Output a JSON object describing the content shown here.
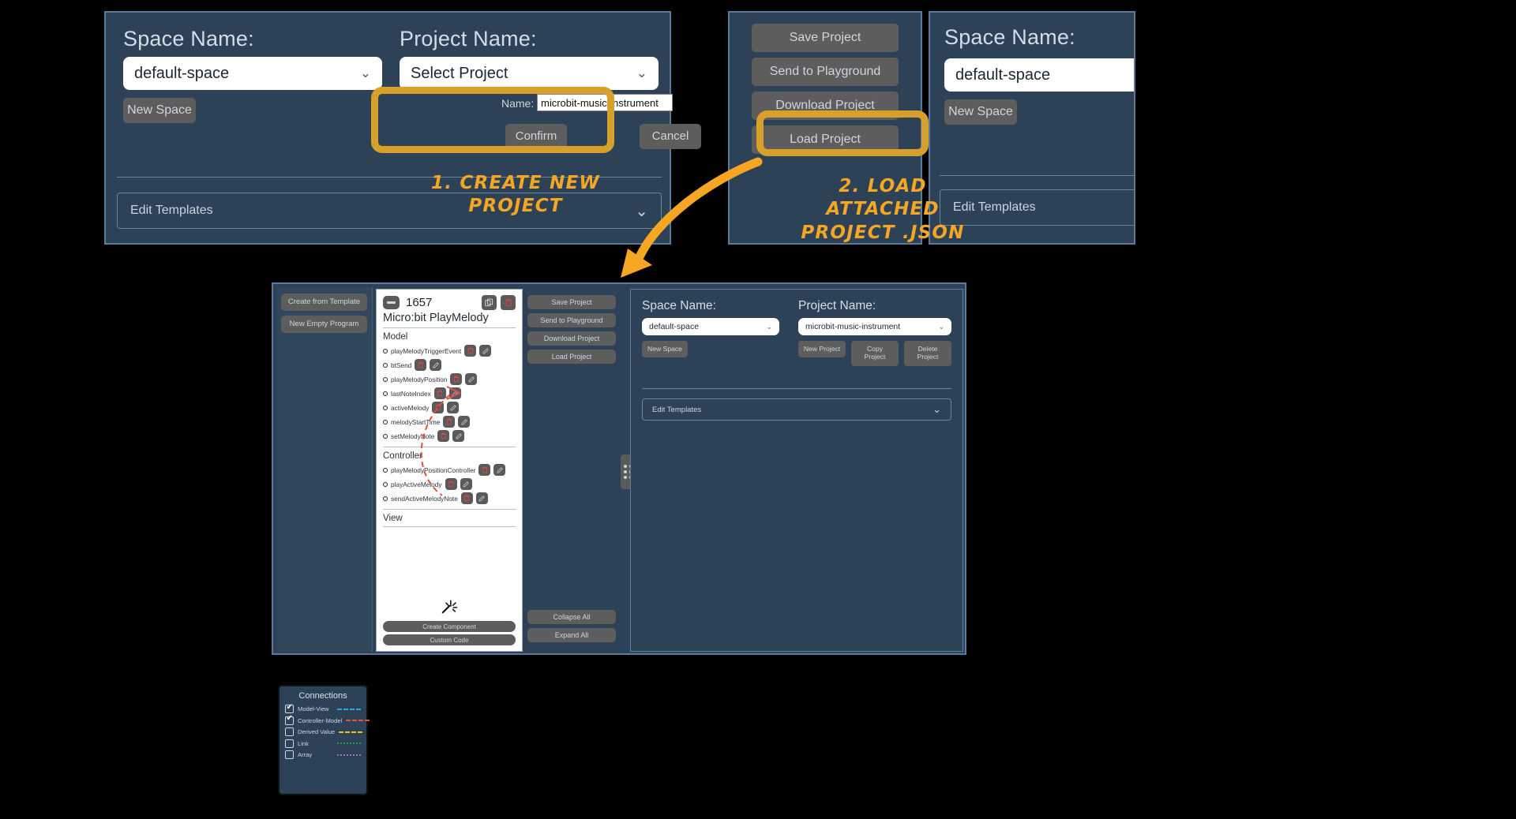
{
  "top_left_panel": {
    "space_label": "Space Name:",
    "project_label": "Project Name:",
    "space_value": "default-space",
    "project_value": "Select Project",
    "new_space_label": "New Space",
    "new_project_form": {
      "name_label": "Name:",
      "name_value": "microbit-music-instrument",
      "confirm_label": "Confirm",
      "cancel_label": "Cancel"
    },
    "edit_templates_label": "Edit Templates"
  },
  "top_mid_panel": {
    "buttons": [
      "Save Project",
      "Send to Playground",
      "Download Project",
      "Load Project"
    ]
  },
  "top_right_panel": {
    "space_label": "Space Name:",
    "space_value": "default-space",
    "new_space_label": "New Space",
    "edit_templates_label": "Edit Templates"
  },
  "annotations": [
    {
      "text": "1. CREATE NEW PROJECT"
    },
    {
      "text": "2. LOAD ATTACHED\nPROJECT .JSON"
    }
  ],
  "app_window": {
    "template_buttons": [
      "Create from Template",
      "New Empty Program"
    ],
    "card": {
      "id": "1657",
      "title": "Micro:bit PlayMelody",
      "collapse_icon": "minus-icon",
      "copy_icon": "copy-icon",
      "delete_icon": "trash-icon",
      "sections": [
        {
          "name": "Model",
          "items": [
            "playMelodyTriggerEvent",
            "btSend",
            "playMelodyPosition",
            "lastNoteIndex",
            "activeMelody",
            "melodyStartTime",
            "setMelodyNote"
          ]
        },
        {
          "name": "Controller",
          "items": [
            "playMelodyPositionController",
            "playActiveMelody",
            "sendActiveMelodyNote"
          ]
        },
        {
          "name": "View",
          "items": []
        }
      ],
      "wand_icon": "magic-wand-icon",
      "footer_buttons": [
        "Create Component",
        "Custom Code"
      ]
    },
    "project_buttons_top": [
      "Save Project",
      "Send to Playground",
      "Download Project",
      "Load Project"
    ],
    "project_buttons_bottom": [
      "Collapse All",
      "Expand All"
    ],
    "drag_handle_icon": "drag-handle-icon",
    "settings": {
      "space_label": "Space Name:",
      "project_label": "Project Name:",
      "space_value": "default-space",
      "project_value": "microbit-music-instrument",
      "new_space_label": "New Space",
      "new_project_label": "New Project",
      "copy_project_label": "Copy\nProject",
      "delete_project_label": "Delete\nProject",
      "edit_templates_label": "Edit Templates"
    }
  },
  "legend": {
    "title": "Connections",
    "items": [
      {
        "label": "Model-View",
        "checked": true,
        "color": "#29a8df",
        "style": "dashed-wide"
      },
      {
        "label": "Controller-Model",
        "checked": true,
        "color": "#e0513f",
        "style": "dashed"
      },
      {
        "label": "Derived Value",
        "checked": false,
        "color": "#e3c518",
        "style": "dashed-tight"
      },
      {
        "label": "Link",
        "checked": false,
        "color": "#1f9a4a",
        "style": "dotted"
      },
      {
        "label": "Array",
        "checked": false,
        "color": "#b069c6",
        "style": "dotted"
      }
    ]
  },
  "colors": {
    "panel_bg": "#2e4257",
    "panel_border": "#587c9e",
    "button_bg": "#5d5d5d",
    "highlight": "#d6a02a",
    "annotation": "#f5a623",
    "page_bg": "#000000"
  }
}
